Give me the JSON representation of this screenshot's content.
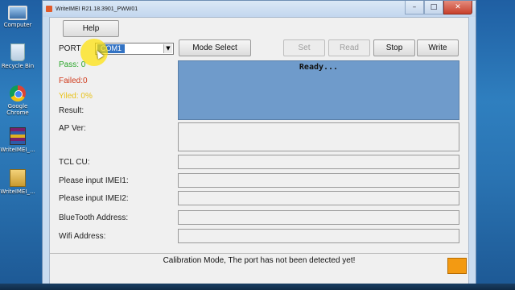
{
  "desktop": {
    "icons": [
      {
        "label": "Computer",
        "icon": "computer-icon"
      },
      {
        "label": "Recycle Bin",
        "icon": "recycle-bin-icon"
      },
      {
        "label": "Google Chrome",
        "icon": "chrome-icon"
      },
      {
        "label": "WriteIMEI_...",
        "icon": "winrar-archive-icon"
      },
      {
        "label": "WriteIMEI_...",
        "icon": "folder-icon"
      }
    ]
  },
  "window": {
    "title": "WriteIMEI R21.18.3901_PWW01",
    "controls": {
      "minimize": "–",
      "maximize": "□",
      "close": "✕"
    }
  },
  "toolbar": {
    "help": "Help",
    "port_label": "PORT",
    "port_value": "COM1",
    "mode_select": "Mode Select",
    "set": "Set",
    "read": "Read",
    "stop": "Stop",
    "write": "Write"
  },
  "stats": {
    "pass": "Pass:  0",
    "failed": "Failed:0",
    "yield": "Yiled:  0%",
    "result": "Result:"
  },
  "status_panel": {
    "text": "Ready..."
  },
  "fields": {
    "ap_ver": "AP Ver:",
    "tcl_cu": "TCL CU:",
    "imei1": "Please input IMEI1:",
    "imei2": "Please input IMEI2:",
    "bluetooth": "BlueTooth Address:",
    "wifi": "Wifi Address:"
  },
  "footer": {
    "message": "Calibration Mode, The port has not been detected yet!",
    "indicator_color": "#f39a12"
  },
  "colors": {
    "pass": "#2aa52a",
    "failed": "#d03a1c",
    "yield": "#e8c21a",
    "status_panel": "#6f9bcb"
  }
}
